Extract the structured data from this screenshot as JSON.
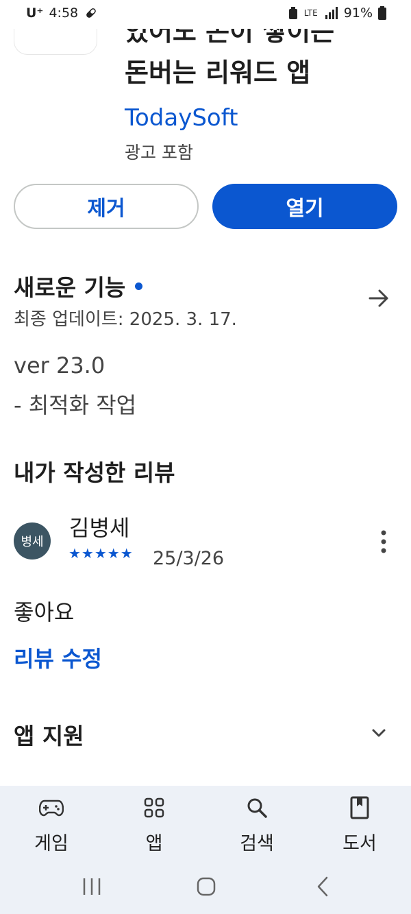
{
  "status_bar": {
    "carrier": "U⁺",
    "time": "4:58",
    "network": "LTE",
    "battery": "91%"
  },
  "app": {
    "title_line1": "있어도 돈이 쌓이는",
    "title_line2": "돈버는 리워드 앱",
    "developer": "TodaySoft",
    "ads_notice": "광고 포함"
  },
  "buttons": {
    "remove": "제거",
    "open": "열기"
  },
  "whats_new": {
    "heading": "새로운 기능",
    "updated": "최종 업데이트: 2025. 3. 17.",
    "version": "ver 23.0",
    "notes": "- 최적화 작업"
  },
  "my_review": {
    "heading": "내가 작성한 리뷰",
    "avatar_text": "병세",
    "reviewer": "김병세",
    "stars": "★★★★★",
    "rating": 5,
    "date": "25/3/26",
    "text": "좋아요",
    "edit_label": "리뷰 수정"
  },
  "app_support": {
    "heading": "앱 지원"
  },
  "bottom_nav": [
    {
      "label": "게임",
      "icon": "gamepad-icon"
    },
    {
      "label": "앱",
      "icon": "apps-grid-icon"
    },
    {
      "label": "검색",
      "icon": "search-icon"
    },
    {
      "label": "도서",
      "icon": "book-icon"
    }
  ],
  "colors": {
    "accent": "#0b57d0",
    "avatar": "#3c5563",
    "nav_bg": "#edf1f7"
  }
}
